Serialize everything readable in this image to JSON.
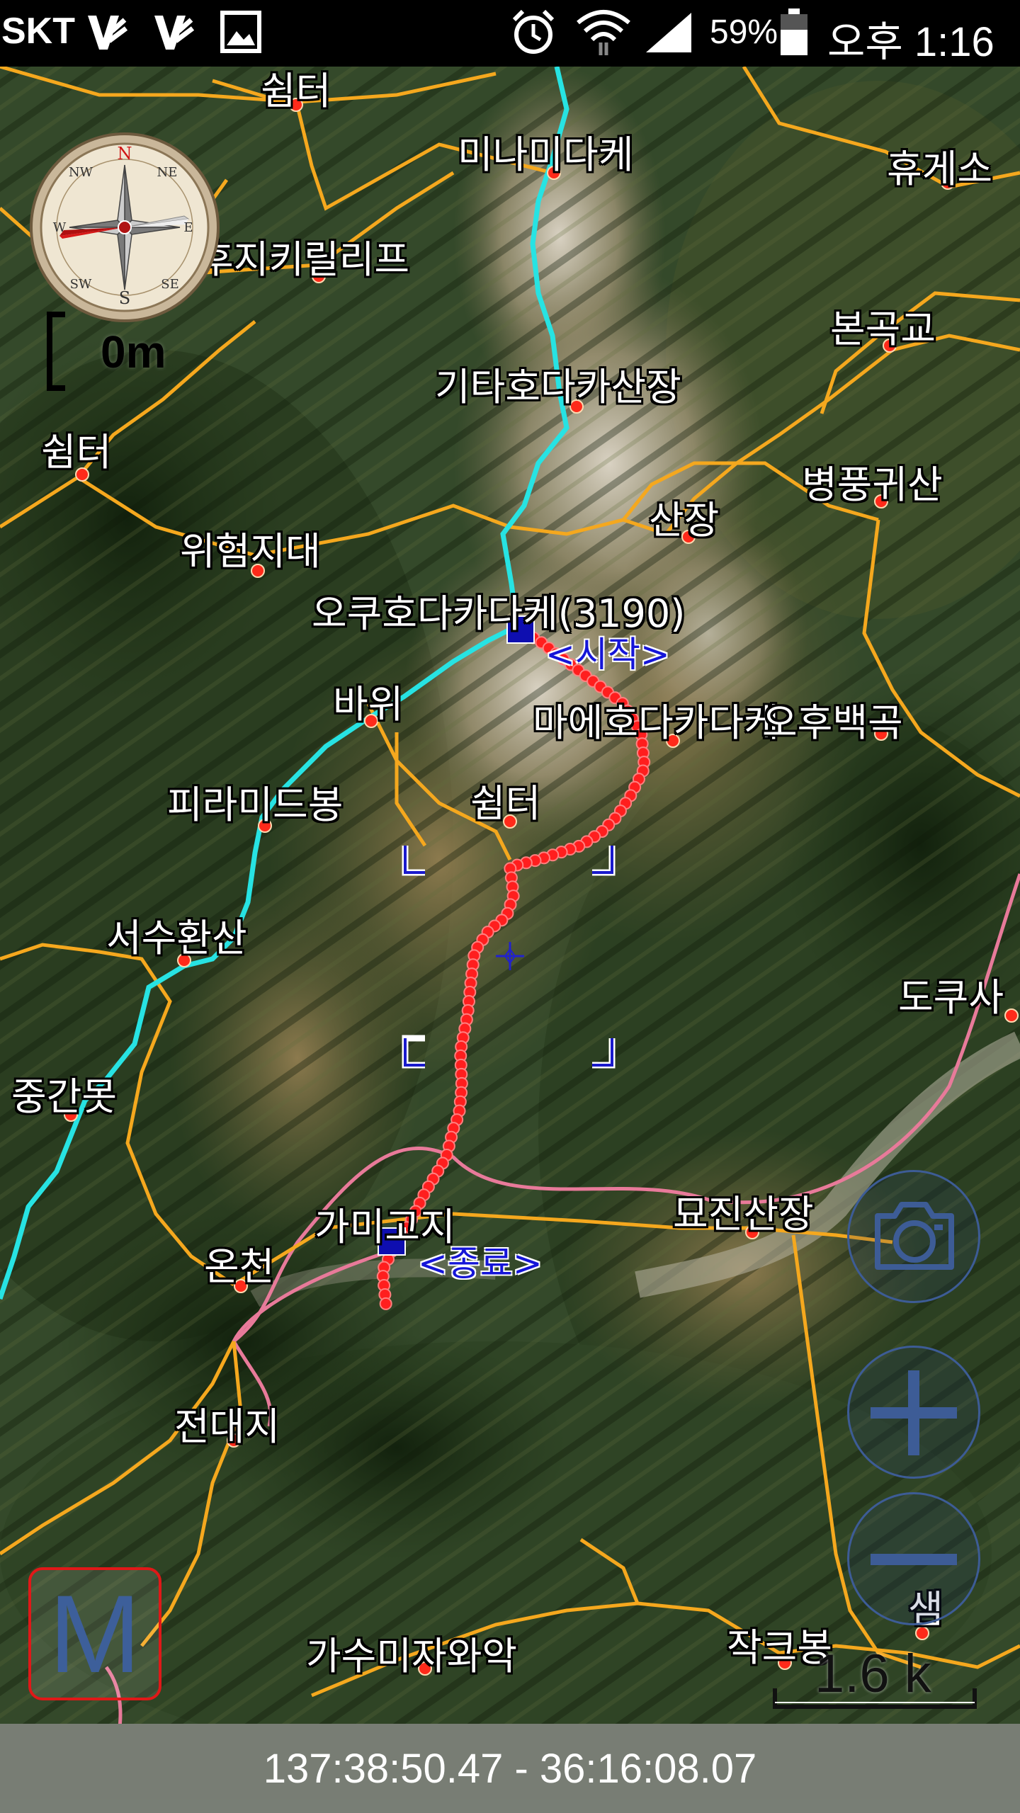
{
  "status_bar": {
    "carrier": "SKT",
    "icons": [
      "notification-v-icon",
      "notification-v-icon",
      "gallery-icon",
      "alarm-icon",
      "wifi-icon",
      "signal-icon",
      "battery-icon"
    ],
    "battery_percent": "59%",
    "time": "오후 1:16"
  },
  "map": {
    "imagery": "satellite-terrain",
    "colors": {
      "road": "#f5a81e",
      "trail_cyan": "#27e3e3",
      "track_red": "#ff1e1e",
      "pink_road": "#e87a9a",
      "marker": "#0e0eb0"
    },
    "places": [
      {
        "name": "쉼터"
      },
      {
        "name": "미나미다케"
      },
      {
        "name": "휴게소"
      },
      {
        "name": "후지키릴리프"
      },
      {
        "name": "본곡교"
      },
      {
        "name": "기타호다카산장"
      },
      {
        "name": "쉼터"
      },
      {
        "name": "병풍귀산"
      },
      {
        "name": "산장"
      },
      {
        "name": "위험지대"
      },
      {
        "name": "오쿠호다카다케(3190)"
      },
      {
        "name": "바위"
      },
      {
        "name": "마에호다카다케"
      },
      {
        "name": "오후백곡"
      },
      {
        "name": "피라미드봉"
      },
      {
        "name": "쉼터"
      },
      {
        "name": "서수환산"
      },
      {
        "name": "도쿠사"
      },
      {
        "name": "중간못"
      },
      {
        "name": "묘진산장"
      },
      {
        "name": "가미고지"
      },
      {
        "name": "온천"
      },
      {
        "name": "전대지"
      },
      {
        "name": "샘"
      },
      {
        "name": "가수미자와악"
      },
      {
        "name": "작크봉"
      }
    ],
    "start_label": "<시작>",
    "end_label": "<종료>"
  },
  "compass": {
    "letters": [
      "N",
      "NE",
      "E",
      "SE",
      "S",
      "SW",
      "W",
      "NW"
    ]
  },
  "scale_left": "0m",
  "scale_right": "1.6 k",
  "buttons": {
    "camera": "camera-icon",
    "zoom_in": "plus-icon",
    "zoom_out": "minus-icon",
    "menu_letter": "M"
  },
  "coordinates": "137:38:50.47 - 36:16:08.07"
}
